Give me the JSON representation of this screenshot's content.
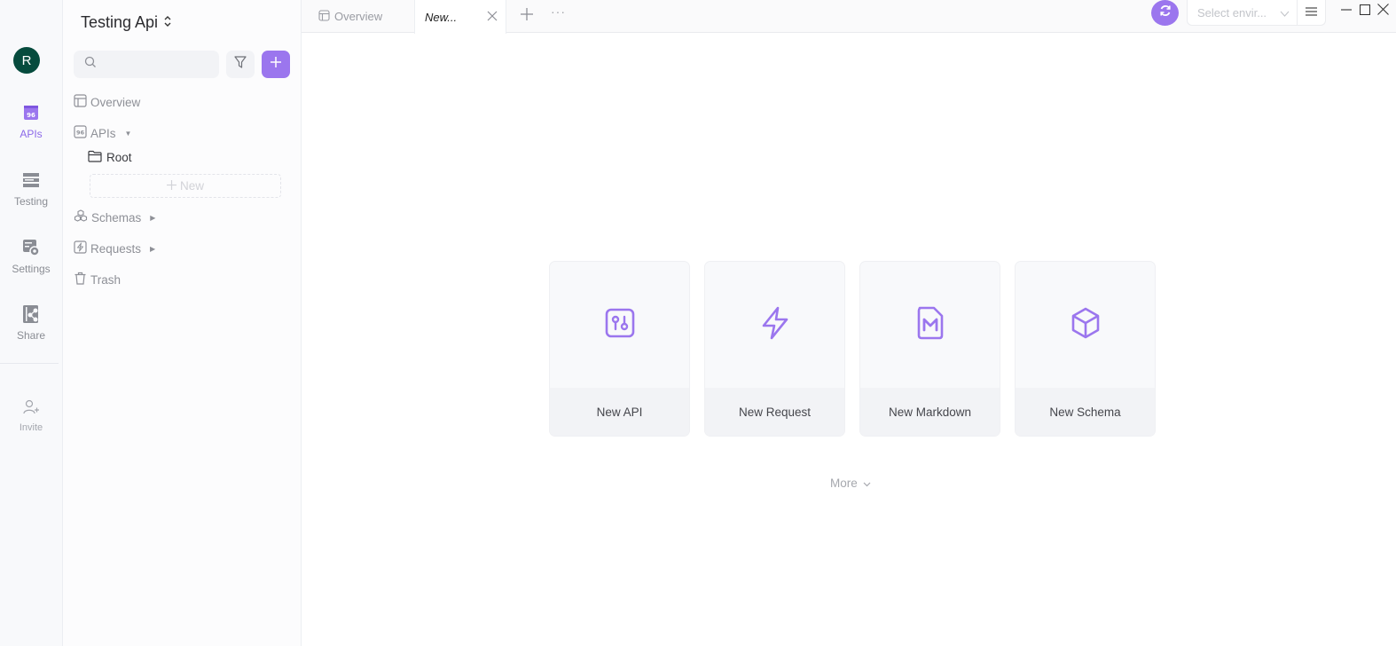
{
  "colors": {
    "accent": "#9b76ee",
    "avatar_bg": "#064b3d"
  },
  "rail": {
    "avatar_initial": "R",
    "items": [
      {
        "label": "APIs",
        "icon": "api-icon",
        "active": true
      },
      {
        "label": "Testing",
        "icon": "testing-icon",
        "active": false
      },
      {
        "label": "Settings",
        "icon": "settings-icon",
        "active": false
      },
      {
        "label": "Share",
        "icon": "share-icon",
        "active": false
      }
    ],
    "invite_label": "Invite"
  },
  "panel": {
    "project_title": "Testing Api",
    "search": {
      "value": "",
      "placeholder": ""
    },
    "tree": [
      {
        "label": "Overview",
        "icon": "overview-icon"
      },
      {
        "label": "APIs",
        "icon": "api-icon",
        "expanded": true
      },
      {
        "label": "Schemas",
        "icon": "schemas-icon",
        "expanded": false
      },
      {
        "label": "Requests",
        "icon": "requests-icon",
        "expanded": false
      },
      {
        "label": "Trash",
        "icon": "trash-icon"
      }
    ],
    "root_folder": "Root",
    "new_label": "New"
  },
  "tabs": [
    {
      "label": "Overview",
      "active": false
    },
    {
      "label": "New...",
      "active": true
    }
  ],
  "toolbar": {
    "env_placeholder": "Select envir..."
  },
  "cards": [
    {
      "label": "New API",
      "icon": "api-icon"
    },
    {
      "label": "New Request",
      "icon": "lightning-icon"
    },
    {
      "label": "New Markdown",
      "icon": "markdown-icon"
    },
    {
      "label": "New Schema",
      "icon": "cube-icon"
    }
  ],
  "more_label": "More"
}
